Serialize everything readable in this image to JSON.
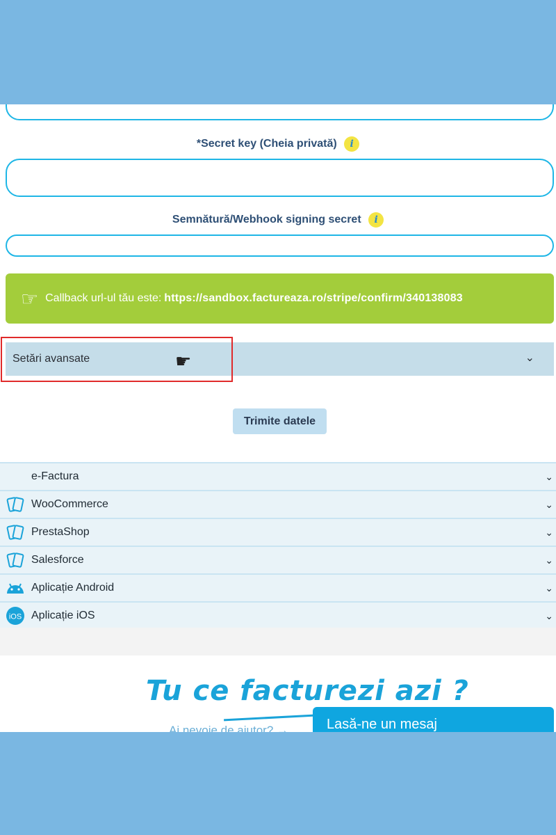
{
  "form": {
    "secret_key_label": "Secret key (Cheia privată)",
    "secret_key_required_mark": "*",
    "secret_key_value": "",
    "webhook_label": "Semnătură/Webhook signing secret",
    "webhook_value": "",
    "info_glyph": "i"
  },
  "callback": {
    "prefix": "Callback url-ul tău este:",
    "url": "https://sandbox.factureaza.ro/stripe/confirm/340138083"
  },
  "advanced": {
    "label": "Setări avansate"
  },
  "submit": {
    "label": "Trimite datele"
  },
  "integrations": [
    {
      "label": "e-Factura",
      "icon": "none"
    },
    {
      "label": "WooCommerce",
      "icon": "plugin-icon"
    },
    {
      "label": "PrestaShop",
      "icon": "plugin-icon"
    },
    {
      "label": "Salesforce",
      "icon": "plugin-icon"
    },
    {
      "label": "Aplicație Android",
      "icon": "android-icon"
    },
    {
      "label": "Aplicație iOS",
      "icon": "ios-icon"
    }
  ],
  "footer": {
    "tagline": "Tu ce facturezi azi ?",
    "help_text": "Ai nevoie de ajutor? →",
    "chat_label": "Lasă-ne un mesaj"
  },
  "colors": {
    "accent": "#1eb6e6",
    "callback_bg": "#a3cd3b",
    "highlight": "#e02a2a",
    "outer_bg": "#7ab7e2"
  }
}
